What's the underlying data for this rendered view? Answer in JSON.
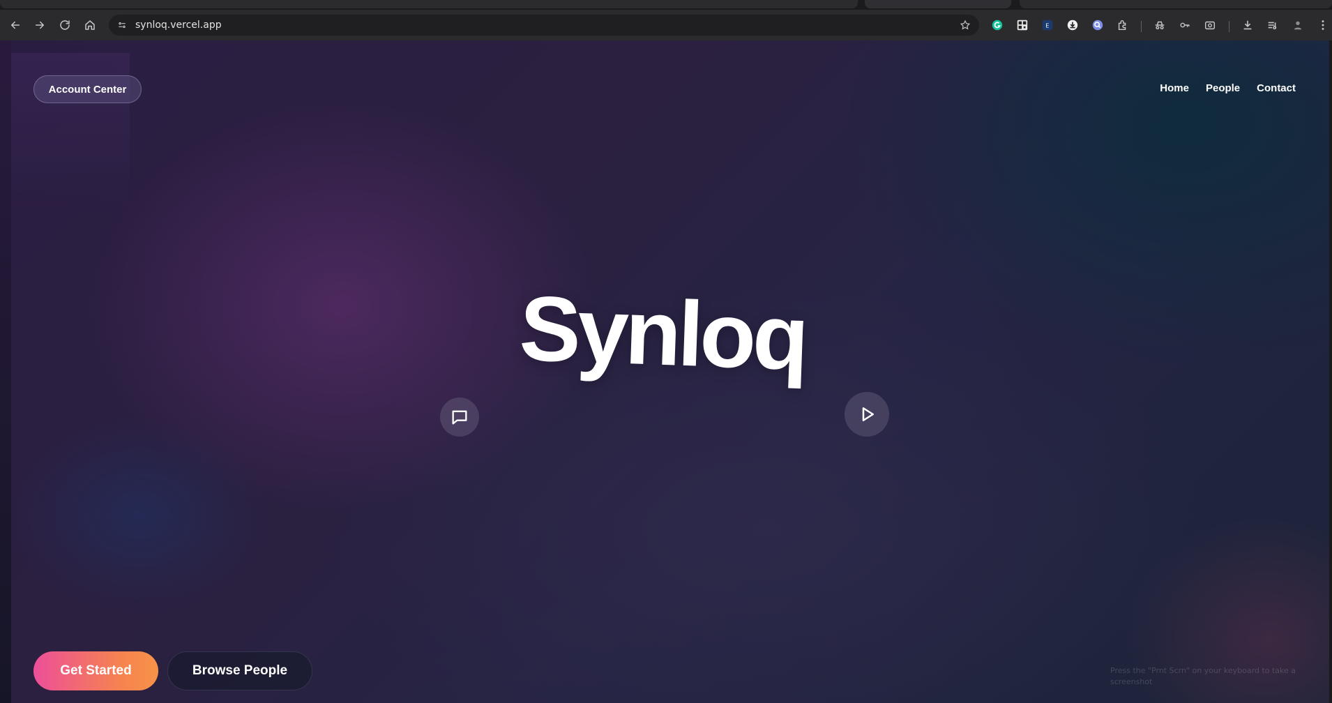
{
  "browser": {
    "url": "synloq.vercel.app",
    "nav_icons": [
      "back-icon",
      "forward-icon",
      "reload-icon",
      "home-icon"
    ],
    "extensions": [
      "grammarly-icon",
      "qr-code-icon",
      "extension-e-icon",
      "download-helper-icon",
      "search-extension-icon",
      "puzzle-icon",
      "incognito-icon",
      "password-key-icon",
      "screenshot-icon",
      "downloads-icon",
      "media-queue-icon",
      "profile-icon",
      "menu-icon"
    ]
  },
  "page": {
    "account_center_label": "Account Center",
    "nav": {
      "home": "Home",
      "people": "People",
      "contact": "Contact"
    },
    "hero_title": "Synloq",
    "cta": {
      "primary": "Get Started",
      "secondary": "Browse People"
    },
    "watermark": "Press the \"Prnt Scrn\" on your keyboard to take a screenshot"
  },
  "colors": {
    "cta_gradient_start": "#ec4f99",
    "cta_gradient_end": "#f79248",
    "background_dark": "#1a2438",
    "background_purple": "#2a1d42"
  }
}
